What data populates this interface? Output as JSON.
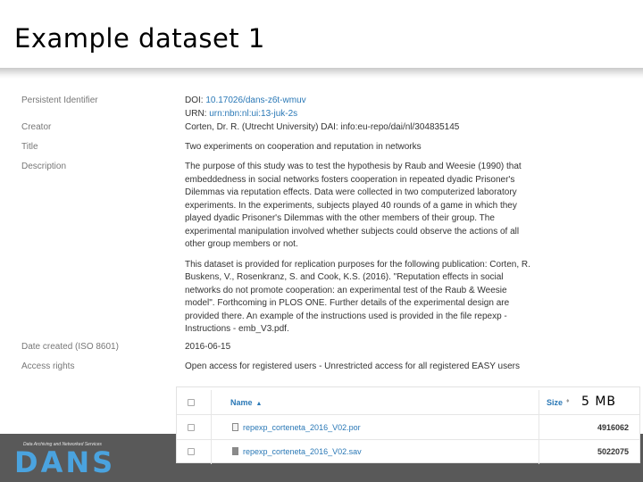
{
  "slide": {
    "title": "Example dataset 1"
  },
  "metadata": {
    "persistent_identifier": {
      "label": "Persistent Identifier",
      "doi_prefix": "DOI: ",
      "doi": "10.17026/dans-z6t-wmuv",
      "urn_prefix": "URN: ",
      "urn": "urn:nbn:nl:ui:13-juk-2s"
    },
    "creator": {
      "label": "Creator",
      "value": "Corten, Dr. R. (Utrecht University) DAI: info:eu-repo/dai/nl/304835145"
    },
    "title": {
      "label": "Title",
      "value": "Two experiments on cooperation and reputation in networks"
    },
    "description": {
      "label": "Description",
      "paragraph_1": "The purpose of this study was to test the hypothesis by Raub and Weesie (1990) that embeddedness in social networks fosters cooperation in repeated dyadic Prisoner's Dilemmas via reputation effects. Data were collected in two computerized laboratory experiments. In the experiments, subjects played 40 rounds of a game in which they played dyadic Prisoner's Dilemmas with the other members of their group. The experimental manipulation involved whether subjects could observe the actions of all other group members or not.",
      "paragraph_2": "This dataset is provided for replication purposes for the following publication: Corten, R. Buskens, V., Rosenkranz, S. and Cook, K.S. (2016). \"Reputation effects in social networks do not promote cooperation: an experimental test of the Raub & Weesie model\". Forthcoming in PLOS ONE. Further details of the experimental design are provided there. An example of the instructions used is provided in the file repexp - Instructions - emb_V3.pdf."
    },
    "date_created": {
      "label": "Date created (ISO 8601)",
      "value": "2016-06-15"
    },
    "access_rights": {
      "label": "Access rights",
      "value": "Open access for registered users - Unrestricted access for all registered EASY users"
    }
  },
  "files": {
    "name_header": "Name",
    "size_header": "Size",
    "size_overlay": "5 MB",
    "rows": [
      {
        "name": "repexp_corteneta_2016_V02.por",
        "size": "4916062"
      },
      {
        "name": "repexp_corteneta_2016_V02.sav",
        "size": "5022075"
      }
    ]
  },
  "footer": {
    "tagline": "Data Archiving and Networked Services",
    "logo": "DANS",
    "colors": {
      "band": "#595959",
      "logo": "#4aa3df",
      "link": "#2a78b6"
    }
  }
}
